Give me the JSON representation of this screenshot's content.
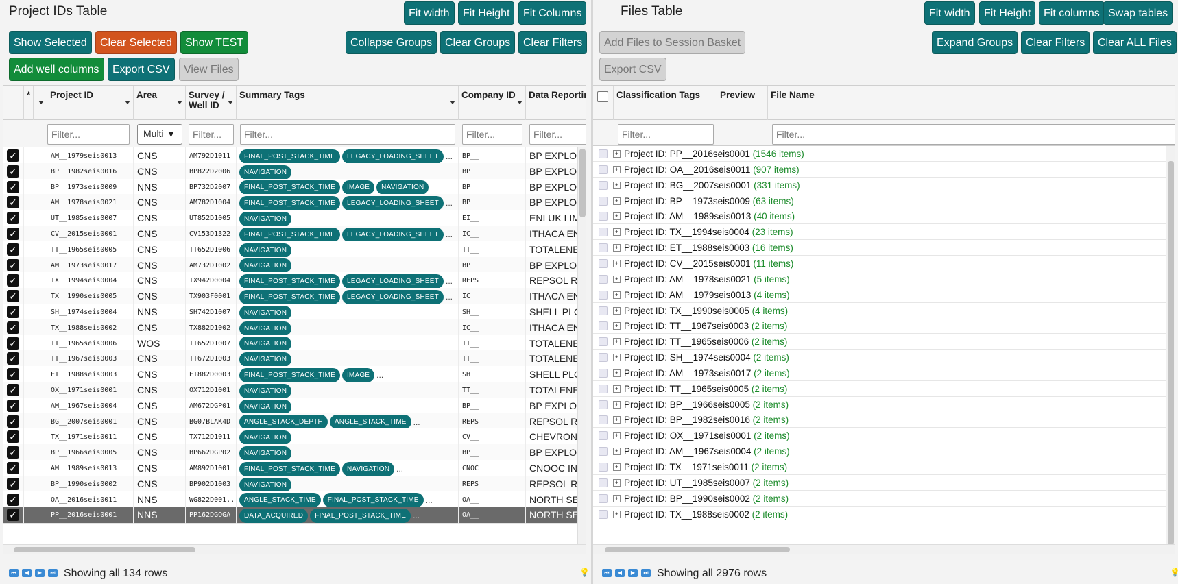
{
  "left": {
    "title": "Project IDs Table",
    "buttons": {
      "fit_width": "Fit width",
      "fit_height": "Fit Height",
      "fit_columns": "Fit Columns",
      "show_selected": "Show Selected",
      "clear_selected": "Clear Selected",
      "show_test": "Show TEST",
      "collapse_groups": "Collapse Groups",
      "clear_groups": "Clear Groups",
      "clear_filters": "Clear Filters",
      "add_well_columns": "Add well columns",
      "export_csv": "Export CSV",
      "view_files": "View Files"
    },
    "columns": {
      "star": "*",
      "project_id": "Project ID",
      "area": "Area",
      "survey_well": "Survey / Well ID",
      "summary_tags": "Summary Tags",
      "company_id": "Company ID",
      "data_reporting": "Data Reporting C"
    },
    "filter_placeholder": "Filter...",
    "area_filter": "Multi ▼",
    "rows": [
      {
        "pid": "AM__1979seis0013",
        "area": "CNS",
        "survey": "AM792D1011",
        "tags": [
          "FINAL_POST_STACK_TIME",
          "LEGACY_LOADING_SHEET"
        ],
        "more": "...",
        "company": "BP__",
        "reporting": "BP EXPLORA"
      },
      {
        "pid": "BP__1982seis0016",
        "area": "CNS",
        "survey": "BP822D2006",
        "tags": [
          "NAVIGATION"
        ],
        "more": "",
        "company": "BP__",
        "reporting": "BP EXPLORA"
      },
      {
        "pid": "BP__1973seis0009",
        "area": "NNS",
        "survey": "BP732D2007",
        "tags": [
          "FINAL_POST_STACK_TIME",
          "IMAGE",
          "NAVIGATION"
        ],
        "more": "",
        "company": "BP__",
        "reporting": "BP EXPLORA"
      },
      {
        "pid": "AM__1978seis0021",
        "area": "CNS",
        "survey": "AM782D1004",
        "tags": [
          "FINAL_POST_STACK_TIME",
          "LEGACY_LOADING_SHEET"
        ],
        "more": "...",
        "company": "BP__",
        "reporting": "BP EXPLORA"
      },
      {
        "pid": "UT__1985seis0007",
        "area": "CNS",
        "survey": "UT852D1005",
        "tags": [
          "NAVIGATION"
        ],
        "more": "",
        "company": "EI__",
        "reporting": "ENI UK LIMIT"
      },
      {
        "pid": "CV__2015seis0001",
        "area": "CNS",
        "survey": "CV153D1322",
        "tags": [
          "FINAL_POST_STACK_TIME",
          "LEGACY_LOADING_SHEET"
        ],
        "more": "...",
        "company": "IC__",
        "reporting": "ITHACA ENE"
      },
      {
        "pid": "TT__1965seis0005",
        "area": "CNS",
        "survey": "TT652D1006",
        "tags": [
          "NAVIGATION"
        ],
        "more": "",
        "company": "TT__",
        "reporting": "TOTALENERG"
      },
      {
        "pid": "AM__1973seis0017",
        "area": "CNS",
        "survey": "AM732D1002",
        "tags": [
          "NAVIGATION"
        ],
        "more": "",
        "company": "BP__",
        "reporting": "BP EXPLORA"
      },
      {
        "pid": "TX__1994seis0004",
        "area": "CNS",
        "survey": "TX942D0004",
        "tags": [
          "FINAL_POST_STACK_TIME",
          "LEGACY_LOADING_SHEET"
        ],
        "more": "...",
        "company": "REPS",
        "reporting": "REPSOL RES"
      },
      {
        "pid": "TX__1990seis0005",
        "area": "CNS",
        "survey": "TX903F0001",
        "tags": [
          "FINAL_POST_STACK_TIME",
          "LEGACY_LOADING_SHEET"
        ],
        "more": "...",
        "company": "IC__",
        "reporting": "ITHACA ENE"
      },
      {
        "pid": "SH__1974seis0004",
        "area": "NNS",
        "survey": "SH742D1007",
        "tags": [
          "NAVIGATION"
        ],
        "more": "",
        "company": "SH__",
        "reporting": "SHELL PLC"
      },
      {
        "pid": "TX__1988seis0002",
        "area": "CNS",
        "survey": "TX882D1002",
        "tags": [
          "NAVIGATION"
        ],
        "more": "",
        "company": "IC__",
        "reporting": "ITHACA ENE"
      },
      {
        "pid": "TT__1965seis0006",
        "area": "WOS",
        "survey": "TT652D1007",
        "tags": [
          "NAVIGATION"
        ],
        "more": "",
        "company": "TT__",
        "reporting": "TOTALENERG"
      },
      {
        "pid": "TT__1967seis0003",
        "area": "CNS",
        "survey": "TT672D1003",
        "tags": [
          "NAVIGATION"
        ],
        "more": "",
        "company": "TT__",
        "reporting": "TOTALENERG"
      },
      {
        "pid": "ET__1988seis0003",
        "area": "CNS",
        "survey": "ET882D0003",
        "tags": [
          "FINAL_POST_STACK_TIME",
          "IMAGE"
        ],
        "more": "...",
        "company": "SH__",
        "reporting": "SHELL PLC"
      },
      {
        "pid": "OX__1971seis0001",
        "area": "CNS",
        "survey": "OX712D1001",
        "tags": [
          "NAVIGATION"
        ],
        "more": "",
        "company": "TT__",
        "reporting": "TOTALENERG"
      },
      {
        "pid": "AM__1967seis0004",
        "area": "CNS",
        "survey": "AM672DGP01",
        "tags": [
          "NAVIGATION"
        ],
        "more": "",
        "company": "BP__",
        "reporting": "BP EXPLORA"
      },
      {
        "pid": "BG__2007seis0001",
        "area": "CNS",
        "survey": "BG07BLAK4D",
        "tags": [
          "ANGLE_STACK_DEPTH",
          "ANGLE_STACK_TIME"
        ],
        "more": "...",
        "company": "REPS",
        "reporting": "REPSOL RES"
      },
      {
        "pid": "TX__1971seis0011",
        "area": "CNS",
        "survey": "TX712D1011",
        "tags": [
          "NAVIGATION"
        ],
        "more": "",
        "company": "CV__",
        "reporting": "CHEVRON C"
      },
      {
        "pid": "BP__1966seis0005",
        "area": "CNS",
        "survey": "BP662DGP02",
        "tags": [
          "NAVIGATION"
        ],
        "more": "",
        "company": "BP__",
        "reporting": "BP EXPLORA"
      },
      {
        "pid": "AM__1989seis0013",
        "area": "CNS",
        "survey": "AM892D1001",
        "tags": [
          "FINAL_POST_STACK_TIME",
          "NAVIGATION"
        ],
        "more": "...",
        "company": "CNOC",
        "reporting": "CNOOC INTE"
      },
      {
        "pid": "BP__1990seis0002",
        "area": "CNS",
        "survey": "BP902D1003",
        "tags": [
          "NAVIGATION"
        ],
        "more": "",
        "company": "REPS",
        "reporting": "REPSOL RES"
      },
      {
        "pid": "OA__2016seis0011",
        "area": "NNS",
        "survey": "WG822D001...",
        "tags": [
          "ANGLE_STACK_TIME",
          "FINAL_POST_STACK_TIME"
        ],
        "more": "...",
        "company": "OA__",
        "reporting": "NORTH SEA"
      },
      {
        "pid": "PP__2016seis0001",
        "area": "NNS",
        "survey": "PP162DGOGA",
        "tags": [
          "DATA_ACQUIRED",
          "FINAL_POST_STACK_TIME"
        ],
        "more": "...",
        "company": "OA__",
        "reporting": "NORTH SEA"
      }
    ],
    "status": "Showing all 134 rows"
  },
  "right": {
    "title": "Files Table",
    "buttons": {
      "fit_width": "Fit width",
      "fit_height": "Fit Height",
      "fit_columns": "Fit columns",
      "swap_tables": "Swap tables",
      "add_files": "Add Files to Session Basket",
      "expand_groups": "Expand Groups",
      "clear_filters": "Clear Filters",
      "clear_all_files": "Clear ALL Files",
      "export_csv": "Export CSV"
    },
    "columns": {
      "classification_tags": "Classification Tags",
      "preview": "Preview",
      "file_name": "File Name"
    },
    "filter_placeholder": "Filter...",
    "group_prefix": "Project ID:",
    "groups": [
      {
        "id": "PP__2016seis0001",
        "count": "(1546 items)"
      },
      {
        "id": "OA__2016seis0011",
        "count": "(907 items)"
      },
      {
        "id": "BG__2007seis0001",
        "count": "(331 items)"
      },
      {
        "id": "BP__1973seis0009",
        "count": "(63 items)"
      },
      {
        "id": "AM__1989seis0013",
        "count": "(40 items)"
      },
      {
        "id": "TX__1994seis0004",
        "count": "(23 items)"
      },
      {
        "id": "ET__1988seis0003",
        "count": "(16 items)"
      },
      {
        "id": "CV__2015seis0001",
        "count": "(11 items)"
      },
      {
        "id": "AM__1978seis0021",
        "count": "(5 items)"
      },
      {
        "id": "AM__1979seis0013",
        "count": "(4 items)"
      },
      {
        "id": "TX__1990seis0005",
        "count": "(4 items)"
      },
      {
        "id": "TT__1967seis0003",
        "count": "(2 items)"
      },
      {
        "id": "TT__1965seis0006",
        "count": "(2 items)"
      },
      {
        "id": "SH__1974seis0004",
        "count": "(2 items)"
      },
      {
        "id": "AM__1973seis0017",
        "count": "(2 items)"
      },
      {
        "id": "TT__1965seis0005",
        "count": "(2 items)"
      },
      {
        "id": "BP__1966seis0005",
        "count": "(2 items)"
      },
      {
        "id": "BP__1982seis0016",
        "count": "(2 items)"
      },
      {
        "id": "OX__1971seis0001",
        "count": "(2 items)"
      },
      {
        "id": "AM__1967seis0004",
        "count": "(2 items)"
      },
      {
        "id": "TX__1971seis0011",
        "count": "(2 items)"
      },
      {
        "id": "UT__1985seis0007",
        "count": "(2 items)"
      },
      {
        "id": "BP__1990seis0002",
        "count": "(2 items)"
      },
      {
        "id": "TX__1988seis0002",
        "count": "(2 items)"
      }
    ],
    "status": "Showing all 2976 rows"
  },
  "colors": {
    "teal": "#0e7176",
    "red": "#d2541e",
    "green": "#128c3a",
    "count_green": "#1b8b2a"
  }
}
